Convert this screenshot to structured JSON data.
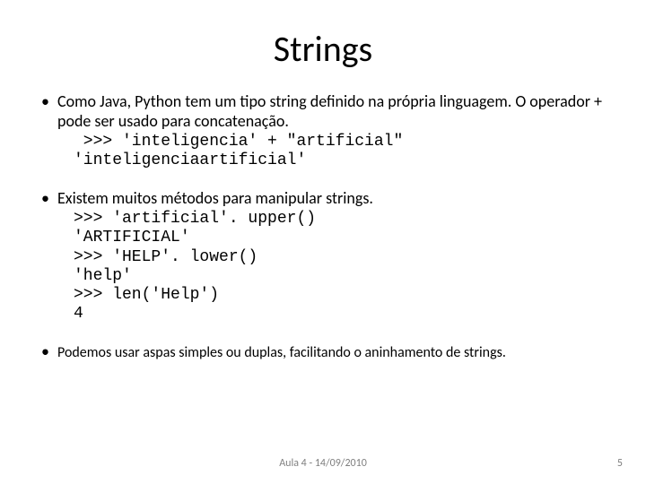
{
  "title": "Strings",
  "bullets": [
    {
      "text": "Como Java, Python tem um tipo string definido na própria linguagem. O operador + pode ser usado para concatenação.",
      "code": " >>> 'inteligencia' + \"artificial\"\n'inteligenciaartificial'",
      "cls": "body-text"
    },
    {
      "text": "Existem muitos métodos para manipular strings.",
      "code": ">>> 'artificial'. upper()\n'ARTIFICIAL'\n>>> 'HELP'. lower()\n'help'\n>>> len('Help')\n4",
      "cls": "body-text"
    },
    {
      "text": "Podemos usar aspas simples ou duplas, facilitando o aninhamento de strings.",
      "code": "",
      "cls": "small-text"
    }
  ],
  "footer_center": "Aula 4 - 14/09/2010",
  "footer_right": "5"
}
